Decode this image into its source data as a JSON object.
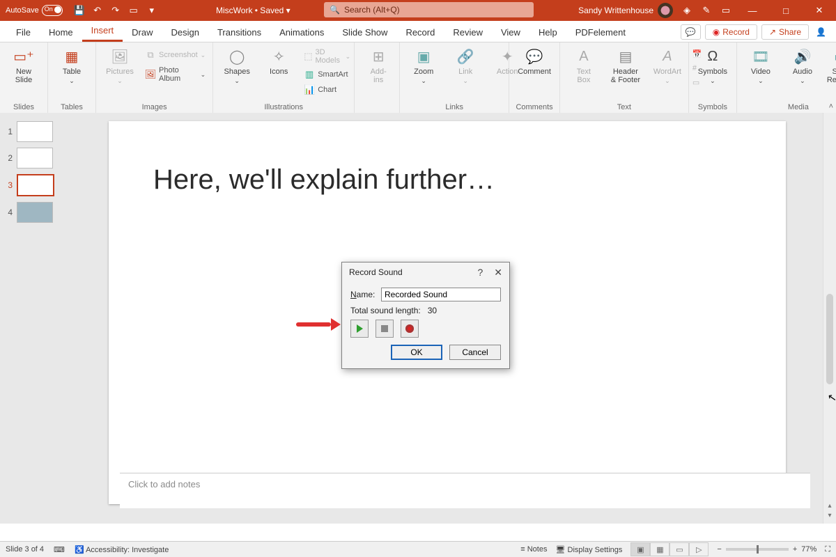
{
  "titlebar": {
    "autosave_label": "AutoSave",
    "autosave_state": "On",
    "doc_title": "MiscWork • Saved ▾",
    "search_placeholder": "Search (Alt+Q)",
    "user_name": "Sandy Writtenhouse"
  },
  "tabs": {
    "items": [
      "File",
      "Home",
      "Insert",
      "Draw",
      "Design",
      "Transitions",
      "Animations",
      "Slide Show",
      "Record",
      "Review",
      "View",
      "Help",
      "PDFelement"
    ],
    "active_index": 2,
    "record_btn": "Record",
    "share_btn": "Share"
  },
  "ribbon": {
    "groups": {
      "slides": {
        "label": "Slides",
        "new_slide": "New\nSlide"
      },
      "tables": {
        "label": "Tables",
        "table": "Table"
      },
      "images": {
        "label": "Images",
        "pictures": "Pictures",
        "screenshot": "Screenshot",
        "photo_album": "Photo Album"
      },
      "illustrations": {
        "label": "Illustrations",
        "shapes": "Shapes",
        "icons": "Icons",
        "models": "3D Models",
        "smartart": "SmartArt",
        "chart": "Chart"
      },
      "addins": {
        "label": "",
        "addins": "Add-\nins"
      },
      "links": {
        "label": "Links",
        "zoom": "Zoom",
        "link": "Link",
        "action": "Action"
      },
      "comments": {
        "label": "Comments",
        "comment": "Comment"
      },
      "text": {
        "label": "Text",
        "textbox": "Text\nBox",
        "header": "Header\n& Footer",
        "wordart": "WordArt"
      },
      "symbols": {
        "label": "Symbols",
        "symbols": "Symbols"
      },
      "media": {
        "label": "Media",
        "video": "Video",
        "audio": "Audio",
        "screen": "Screen\nRecording"
      }
    }
  },
  "slide": {
    "title": "Here, we'll explain further…"
  },
  "thumbs": [
    {
      "n": "1"
    },
    {
      "n": "2"
    },
    {
      "n": "3"
    },
    {
      "n": "4"
    }
  ],
  "dialog": {
    "title": "Record Sound",
    "name_label_pre": "N",
    "name_label_post": "ame:",
    "name_value": "Recorded Sound",
    "length_label": "Total sound length:",
    "length_value": "30",
    "ok": "OK",
    "cancel": "Cancel"
  },
  "notes": {
    "placeholder": "Click to add notes"
  },
  "status": {
    "slide": "Slide 3 of 4",
    "a11y": "Accessibility: Investigate",
    "notes": "Notes",
    "display": "Display Settings",
    "zoom": "77%"
  }
}
